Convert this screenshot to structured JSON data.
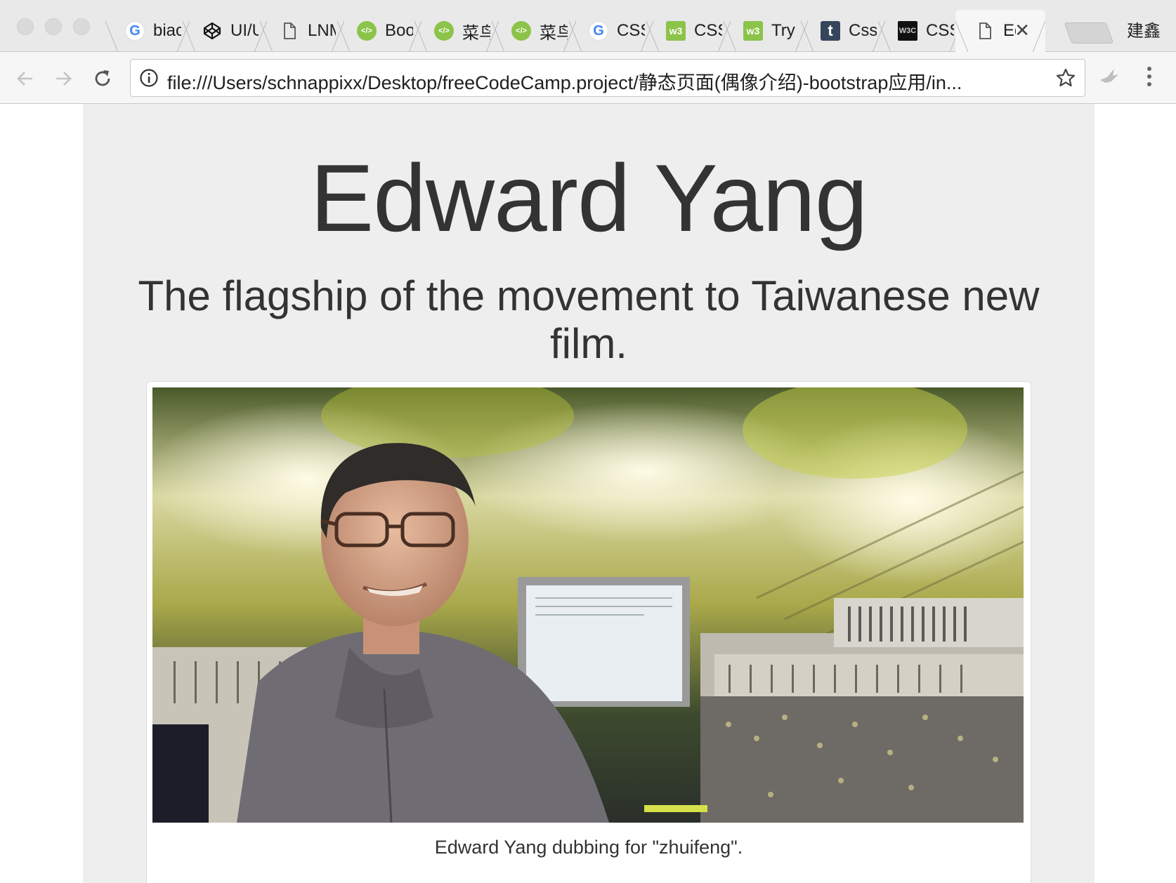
{
  "browser": {
    "tabs": [
      {
        "icon": "google-icon",
        "label": "biao"
      },
      {
        "icon": "codepen-icon",
        "label": "UI/UX"
      },
      {
        "icon": "document-icon",
        "label": "LNMP"
      },
      {
        "icon": "runoob-icon",
        "label": "Boot"
      },
      {
        "icon": "runoob-icon",
        "label": "菜鸟"
      },
      {
        "icon": "runoob-icon",
        "label": "菜鸟"
      },
      {
        "icon": "google-icon",
        "label": "CSS"
      },
      {
        "icon": "w3school-icon",
        "label": "CSS"
      },
      {
        "icon": "w3school-icon",
        "label": "Try"
      },
      {
        "icon": "tumblr-icon",
        "label": "Css"
      },
      {
        "icon": "w3c-icon",
        "label": "CSS"
      },
      {
        "icon": "document-icon",
        "label": "Ed",
        "active": true
      }
    ],
    "profile_name": "建鑫",
    "address_bar": {
      "url": "file:///Users/schnappixx/Desktop/freeCodeCamp.project/静态页面(偶像介绍)-bootstrap应用/in..."
    }
  },
  "page": {
    "title": "Edward Yang",
    "subtitle": "The flagship of the movement to Taiwanese new film.",
    "image_caption": "Edward Yang dubbing for \"zhuifeng\"."
  },
  "colors": {
    "container_bg": "#eeeeee",
    "text": "#333333",
    "tabstrip_bg": "#e9e9e9",
    "toolbar_bg": "#f6f6f6"
  }
}
